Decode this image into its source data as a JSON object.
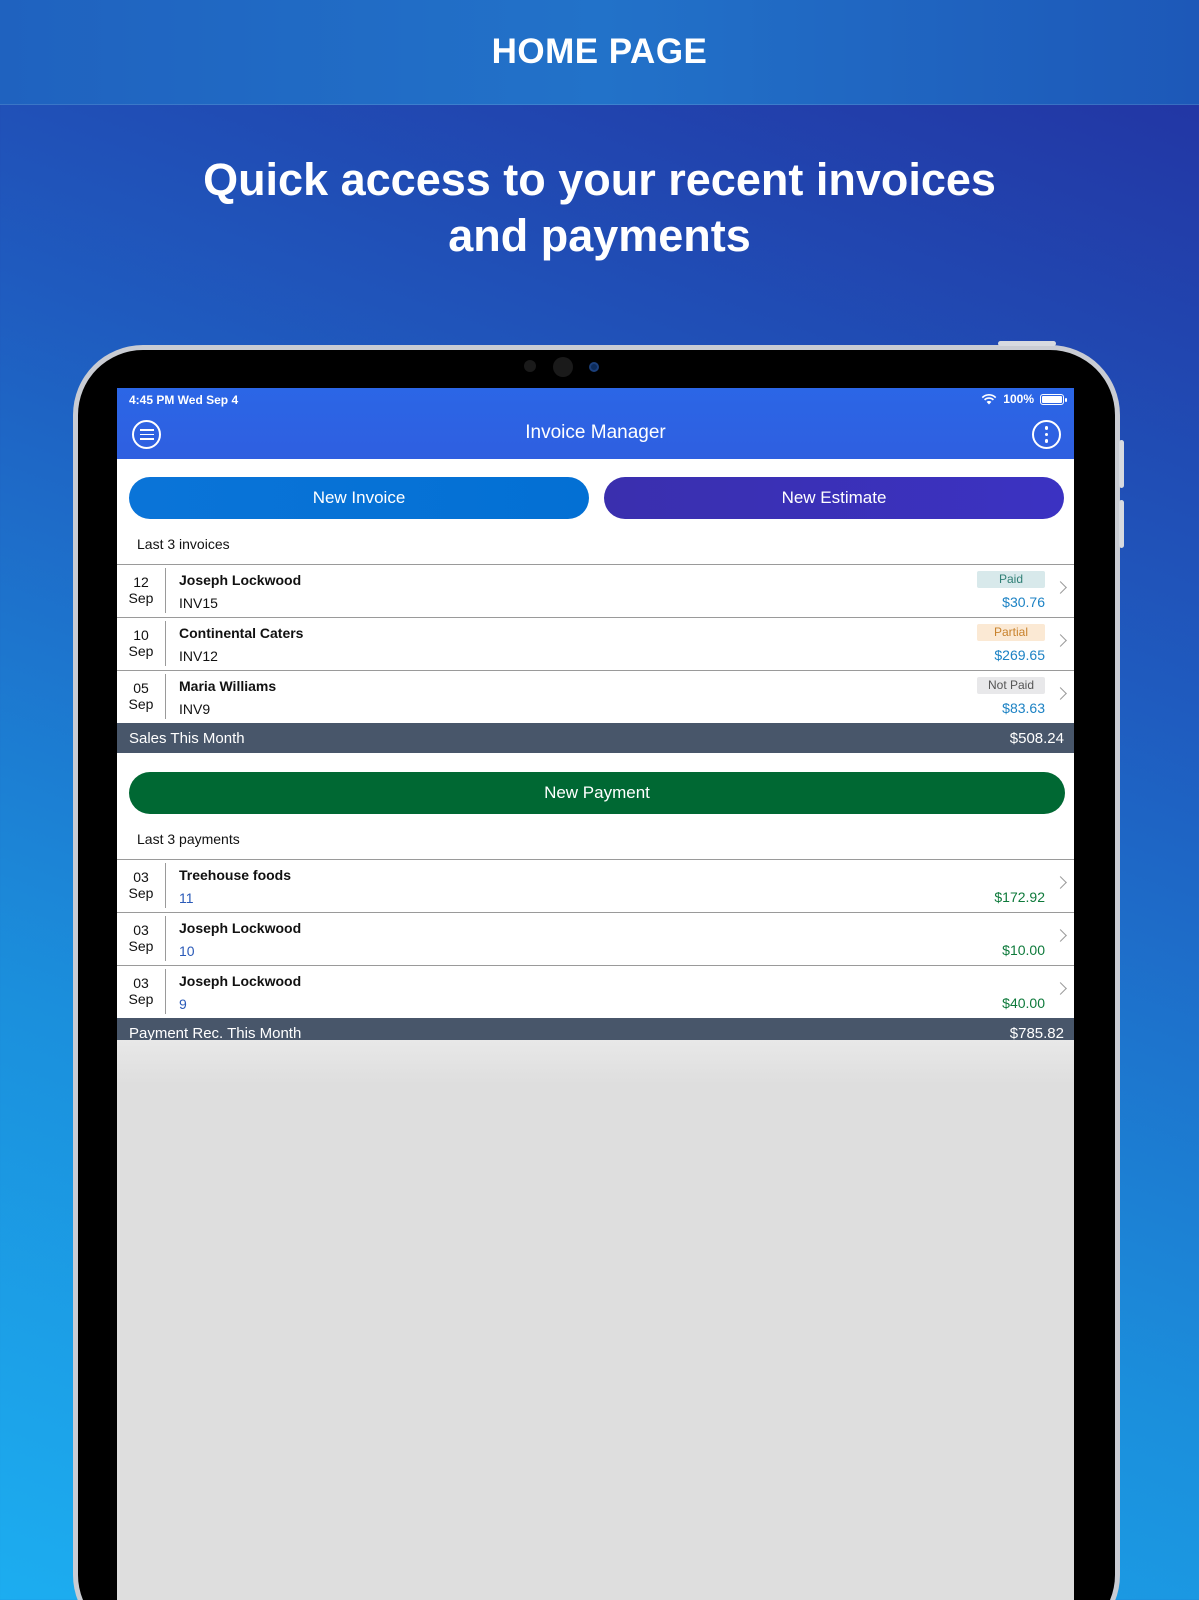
{
  "promo": {
    "header": "HOME PAGE",
    "tagline_line1": "Quick access to your recent invoices",
    "tagline_line2": "and payments"
  },
  "status_bar": {
    "time": "4:45 PM   Wed Sep 4",
    "battery": "100%",
    "icons": [
      "wifi-icon",
      "battery-icon"
    ]
  },
  "nav": {
    "title": "Invoice Manager",
    "left_icon": "menu-icon",
    "right_icon": "more-icon"
  },
  "actions": {
    "new_invoice": "New Invoice",
    "new_estimate": "New Estimate",
    "new_payment": "New Payment"
  },
  "invoices": {
    "section_label": "Last 3 invoices",
    "items": [
      {
        "day": "12",
        "month": "Sep",
        "name": "Joseph Lockwood",
        "number": "INV15",
        "status": "Paid",
        "amount": "$30.76"
      },
      {
        "day": "10",
        "month": "Sep",
        "name": "Continental Caters",
        "number": "INV12",
        "status": "Partial",
        "amount": "$269.65"
      },
      {
        "day": "05",
        "month": "Sep",
        "name": "Maria Williams",
        "number": "INV9",
        "status": "Not Paid",
        "amount": "$83.63"
      }
    ],
    "summary_label": "Sales This Month",
    "summary_value": "$508.24"
  },
  "payments": {
    "section_label": "Last 3 payments",
    "items": [
      {
        "day": "03",
        "month": "Sep",
        "name": "Treehouse foods",
        "number": "11",
        "amount": "$172.92"
      },
      {
        "day": "03",
        "month": "Sep",
        "name": "Joseph Lockwood",
        "number": "10",
        "amount": "$10.00"
      },
      {
        "day": "03",
        "month": "Sep",
        "name": "Joseph Lockwood",
        "number": "9",
        "amount": "$40.00"
      }
    ],
    "summary_label": "Payment Rec. This Month",
    "summary_value": "$785.82"
  },
  "colors": {
    "appbar": "#2b66e6",
    "new_invoice": "#0a74d8",
    "new_estimate": "#3b32c2",
    "new_payment": "#006833",
    "summary_bar": "#48566a",
    "amount_invoice": "#1c82c4",
    "amount_payment": "#0e7a3b"
  }
}
